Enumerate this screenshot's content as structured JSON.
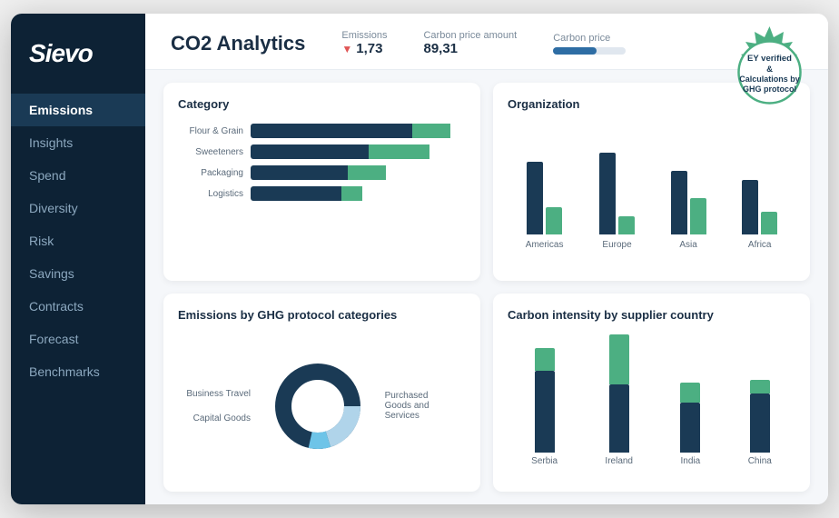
{
  "sidebar": {
    "logo": "Sievo",
    "items": [
      {
        "label": "Emissions",
        "active": true
      },
      {
        "label": "Insights",
        "active": false
      },
      {
        "label": "Spend",
        "active": false
      },
      {
        "label": "Diversity",
        "active": false
      },
      {
        "label": "Risk",
        "active": false
      },
      {
        "label": "Savings",
        "active": false
      },
      {
        "label": "Contracts",
        "active": false
      },
      {
        "label": "Forecast",
        "active": false
      },
      {
        "label": "Benchmarks",
        "active": false
      }
    ]
  },
  "header": {
    "title": "CO2 Analytics",
    "metrics": [
      {
        "label": "Emissions",
        "value": "▼ 1,73",
        "has_arrow": true
      },
      {
        "label": "Carbon price amount",
        "value": "89,31",
        "has_arrow": false
      },
      {
        "label": "Carbon price",
        "value": "",
        "has_bar": true
      }
    ]
  },
  "category_card": {
    "title": "Category",
    "bars": [
      {
        "label": "Flour & Grain",
        "dark_pct": 75,
        "green_pct": 18
      },
      {
        "label": "Sweeteners",
        "dark_pct": 55,
        "green_pct": 28
      },
      {
        "label": "Packaging",
        "dark_pct": 45,
        "green_pct": 18
      },
      {
        "label": "Logistics",
        "dark_pct": 42,
        "green_pct": 10
      }
    ]
  },
  "organization_card": {
    "title": "Organization",
    "groups": [
      {
        "label": "Americas",
        "bar1_h": 80,
        "bar2_h": 30
      },
      {
        "label": "Europe",
        "bar1_h": 90,
        "bar2_h": 20
      },
      {
        "label": "Asia",
        "bar1_h": 70,
        "bar2_h": 40
      },
      {
        "label": "Africa",
        "bar1_h": 60,
        "bar2_h": 25
      }
    ]
  },
  "ghg_card": {
    "title": "Emissions by GHG protocol categories",
    "labels_left": [
      "Business Travel",
      "Capital Goods"
    ],
    "label_right": "Purchased Goods and Services"
  },
  "intensity_card": {
    "title": "Carbon intensity by supplier country",
    "groups": [
      {
        "label": "Serbia",
        "dark_h": 90,
        "green_h": 25
      },
      {
        "label": "Ireland",
        "dark_h": 75,
        "green_h": 55
      },
      {
        "label": "India",
        "dark_h": 55,
        "green_h": 22
      },
      {
        "label": "China",
        "dark_h": 65,
        "green_h": 15
      }
    ]
  },
  "badge": {
    "line1": "EY verified",
    "line2": "&",
    "line3": "Calculations by",
    "line4": "GHG protocol"
  }
}
